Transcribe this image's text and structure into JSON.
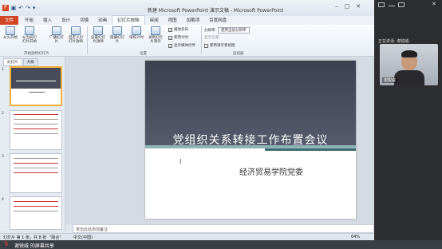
{
  "window_title": "新建 Microsoft PowerPoint 演示文稿 - Microsoft PowerPoint",
  "tabs": [
    "文件",
    "开始",
    "插入",
    "设计",
    "切换",
    "动画",
    "幻灯片放映",
    "审阅",
    "视图",
    "加载项",
    "百度网盘"
  ],
  "ribbon": {
    "buttons": [
      "从头开始",
      "从当前幻灯片开始",
      "广播幻灯片",
      "自定义幻灯片放映",
      "设置幻灯片放映",
      "隐藏幻灯片",
      "排练计时",
      "录制幻灯片演示"
    ],
    "checkboxes": [
      "播放旁白",
      "使用计时",
      "显示媒体控件"
    ],
    "resolution_label": "分辨率:",
    "resolution_value": "使用当前分辨率",
    "show_on_label": "显示位置:",
    "presenter_view": "使用演示者视图",
    "groups": [
      "开始放映幻灯片",
      "设置",
      "监视器"
    ]
  },
  "pane_tabs": [
    "幻灯片",
    "大纲"
  ],
  "thumbnails": [
    "1",
    "2",
    "3",
    "4"
  ],
  "slide": {
    "title": "党组织关系转接工作布置会议",
    "subtitle": "经济贸易学院党委"
  },
  "notes_placeholder": "单击此处添加备注",
  "status": {
    "slide_info": "幻灯片 第 1 张，共 8 张",
    "theme": "\"融合\"",
    "lang": "中文(中国)",
    "zoom": "64%"
  },
  "share_label": "谢锐威 的屏幕共享",
  "right_panel": {
    "speaking": "正在讲话: 谢锐威;",
    "video_name": "谢锐威"
  },
  "colors": {
    "file_tab": "#d24625",
    "slide_title_bg": "#3c4050",
    "meeting_bg": "#2b2d31"
  }
}
